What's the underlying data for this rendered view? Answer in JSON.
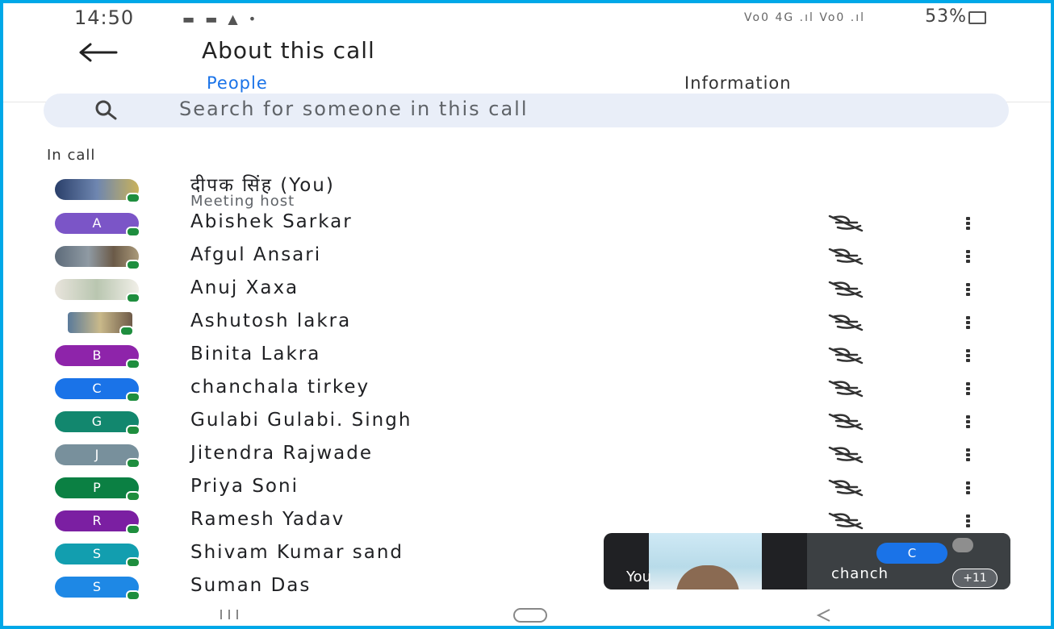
{
  "status": {
    "time": "14:50",
    "notif_icons": "▬ ▬ ▲ •",
    "signal": "Vo0 4G .ıl Vo0 .ıl",
    "battery": "53%"
  },
  "header": {
    "title": "About this call"
  },
  "tabs": [
    {
      "label": "People",
      "active": true
    },
    {
      "label": "Information",
      "active": false
    }
  ],
  "search": {
    "placeholder": "Search for someone in this call"
  },
  "section_label": "In call",
  "participants": [
    {
      "name": "दीपक सिंह (You)",
      "role": "Meeting host",
      "initial": "",
      "color": ""
    },
    {
      "name": "Abishek Sarkar",
      "initial": "A",
      "color": "#7b55c7"
    },
    {
      "name": "Afgul Ansari",
      "initial": "",
      "color": ""
    },
    {
      "name": "Anuj Xaxa",
      "initial": "",
      "color": ""
    },
    {
      "name": "Ashutosh lakra",
      "initial": "",
      "color": ""
    },
    {
      "name": "Binita Lakra",
      "initial": "B",
      "color": "#8e24aa"
    },
    {
      "name": "chanchala tirkey",
      "initial": "C",
      "color": "#1a73e8"
    },
    {
      "name": "Gulabi Gulabi. Singh",
      "initial": "G",
      "color": "#12876e"
    },
    {
      "name": "Jitendra Rajwade",
      "initial": "J",
      "color": "#78909c"
    },
    {
      "name": "Priya Soni",
      "initial": "P",
      "color": "#0b8043"
    },
    {
      "name": "Ramesh Yadav",
      "initial": "R",
      "color": "#7b1fa2"
    },
    {
      "name": "Shivam Kumar sand",
      "initial": "S",
      "color": "#129eaf"
    },
    {
      "name": "Suman Das",
      "initial": "S",
      "color": "#1e88e5"
    }
  ],
  "pip": {
    "self_label": "You",
    "other_initial": "C",
    "other_name": "chanch",
    "overflow_badge": "+11"
  },
  "colors": {
    "accent": "#1a73e8",
    "online": "#1e8e3e",
    "frame": "#00a8e8"
  }
}
